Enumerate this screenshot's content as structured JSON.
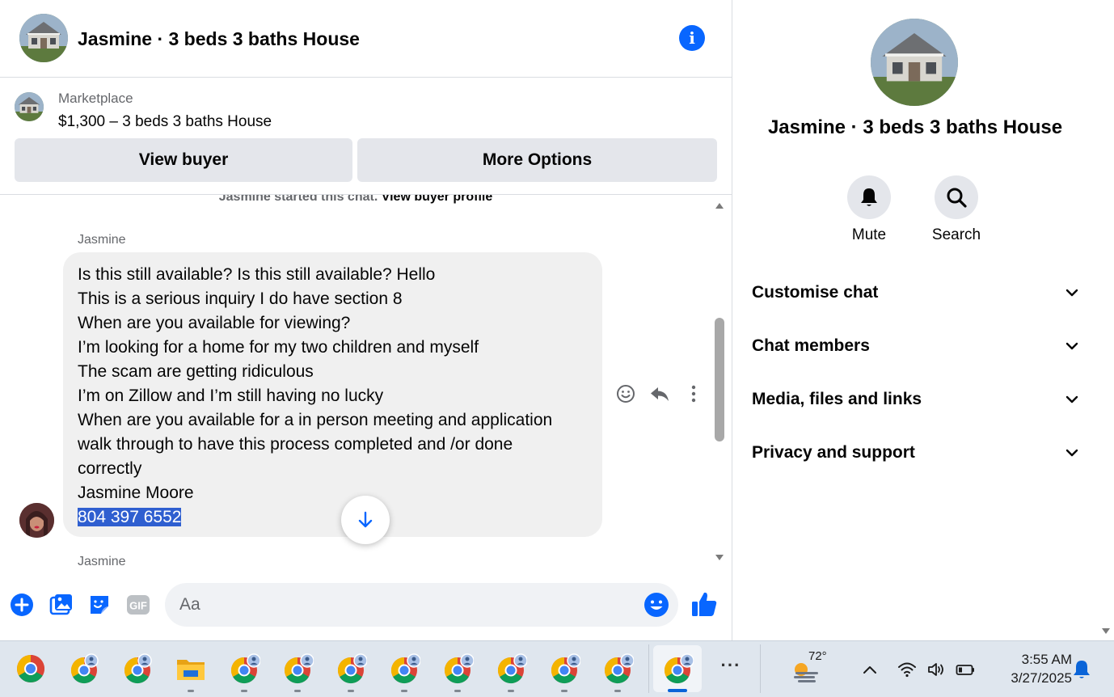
{
  "header": {
    "title": "Jasmine · 3 beds 3 baths House",
    "info_icon": "i"
  },
  "listing": {
    "source": "Marketplace",
    "title": "$1,300 – 3 beds 3 baths House",
    "view_buyer_label": "View buyer",
    "more_options_label": "More Options"
  },
  "conversation": {
    "started_text": "Jasmine started this chat.",
    "view_profile_link": "View buyer profile",
    "sender_name": "Jasmine",
    "message_lines": [
      "Is this still available? Is this still available? Hello",
      "This is a serious inquiry I do have section 8",
      "When are you available for viewing?",
      "I’m looking for a home for my two children and myself",
      "The scam are getting ridiculous",
      "I’m on Zillow and I’m still having no lucky",
      "When are you available for a in person meeting and application",
      "walk through to have this process completed and /or done",
      "correctly",
      "Jasmine Moore"
    ],
    "selected_line": "804 397 6552",
    "next_sender_name": "Jasmine"
  },
  "composer": {
    "placeholder": "Aa",
    "gif_label": "GIF"
  },
  "details": {
    "title": "Jasmine · 3 beds 3 baths House",
    "mute_label": "Mute",
    "search_label": "Search",
    "sections": [
      "Customise chat",
      "Chat members",
      "Media, files and links",
      "Privacy and support"
    ]
  },
  "taskbar": {
    "more_label": "···",
    "weather_temp": "72°",
    "time": "3:55 AM",
    "date": "3/27/2025"
  },
  "colors": {
    "accent": "#0866ff",
    "bubble": "#f0f0f0",
    "button_bg": "#e4e6eb",
    "selection": "#2f5fd0",
    "taskbar_bg": "#dfe6ee"
  }
}
